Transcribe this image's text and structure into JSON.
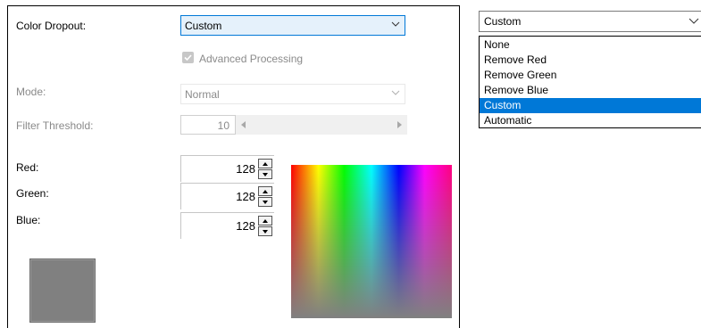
{
  "form": {
    "color_dropout_label": "Color Dropout:",
    "color_dropout_value": "Custom",
    "advanced_processing_label": "Advanced Processing",
    "advanced_processing_checked": true,
    "mode_label": "Mode:",
    "mode_value": "Normal",
    "filter_threshold_label": "Filter Threshold:",
    "filter_threshold_value": "10",
    "red_label": "Red:",
    "red_value": "128",
    "green_label": "Green:",
    "green_value": "128",
    "blue_label": "Blue:",
    "blue_value": "128",
    "preview_color": "#808080"
  },
  "dropdown": {
    "selected": "Custom",
    "options": [
      {
        "label": "None"
      },
      {
        "label": "Remove Red"
      },
      {
        "label": "Remove Green"
      },
      {
        "label": "Remove Blue"
      },
      {
        "label": "Custom",
        "selected": true
      },
      {
        "label": "Automatic"
      }
    ]
  },
  "colors": {
    "accent": "#0078d7",
    "disabled_text": "#8a8a8a",
    "combo_highlight": "#e5f1fb"
  }
}
